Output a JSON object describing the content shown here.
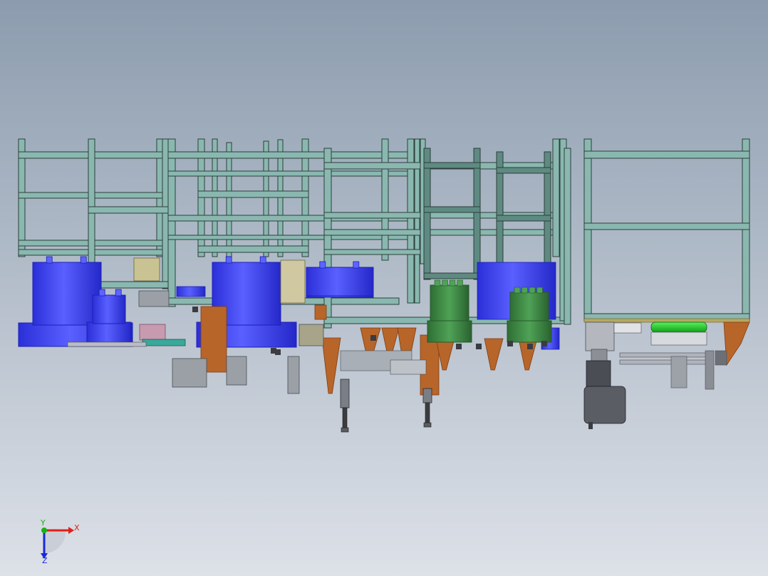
{
  "viewport": {
    "background_top": "#8c9cae",
    "background_bottom": "#dde1e8"
  },
  "colors": {
    "frame_fill": "#8ab8b0",
    "frame_stroke": "#2c3f3a",
    "frame_dark": "#5e8a82",
    "motor_blue": "#3a3ff0",
    "motor_blue_dark": "#1c20b8",
    "motor_green": "#3f8a44",
    "motor_green_dark": "#24592a",
    "bracket_orange": "#b8652a",
    "bracket_orange_dark": "#7c3e14",
    "gray_part": "#9aa0a6",
    "dark_part": "#4a4e54",
    "olive_panel": "#c9c393",
    "bright_green": "#22d02a",
    "pink_part": "#c79ab0"
  },
  "triad": {
    "x_label": "X",
    "y_label": "Y",
    "z_label": "Z",
    "x_color": "#e0201a",
    "y_color": "#1ab01a",
    "z_color": "#1a2ad8"
  }
}
